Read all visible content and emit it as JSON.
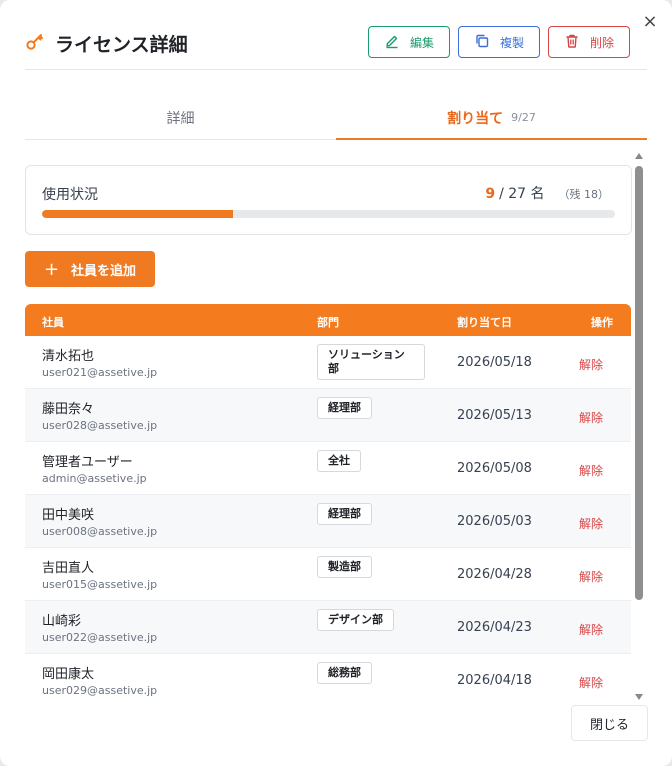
{
  "modal": {
    "title": "ライセンス詳細",
    "close_label": "×",
    "footer_close": "閉じる"
  },
  "toolbar": {
    "edit_label": "編集",
    "copy_label": "複製",
    "delete_label": "削除"
  },
  "tabs": [
    {
      "label": "詳細",
      "count": ""
    },
    {
      "label": "割り当て",
      "count": "9/27"
    }
  ],
  "usage": {
    "label": "使用状況",
    "used": "9",
    "total": "/ 27 名",
    "remaining": "（残 18）",
    "fraction": 0.3333
  },
  "add_button": {
    "plus": "+",
    "label": "社員を追加"
  },
  "table": {
    "headers": [
      "社員",
      "部門",
      "割り当て日",
      "操作"
    ],
    "rows": [
      {
        "name": "清水拓也",
        "email": "user021@assetive.jp",
        "dept": "ソリューション部",
        "date": "2026/05/18",
        "action": "解除"
      },
      {
        "name": "藤田奈々",
        "email": "user028@assetive.jp",
        "dept": "経理部",
        "date": "2026/05/13",
        "action": "解除"
      },
      {
        "name": "管理者ユーザー",
        "email": "admin@assetive.jp",
        "dept": "全社",
        "date": "2026/05/08",
        "action": "解除"
      },
      {
        "name": "田中美咲",
        "email": "user008@assetive.jp",
        "dept": "経理部",
        "date": "2026/05/03",
        "action": "解除"
      },
      {
        "name": "吉田直人",
        "email": "user015@assetive.jp",
        "dept": "製造部",
        "date": "2026/04/28",
        "action": "解除"
      },
      {
        "name": "山崎彩",
        "email": "user022@assetive.jp",
        "dept": "デザイン部",
        "date": "2026/04/23",
        "action": "解除"
      },
      {
        "name": "岡田康太",
        "email": "user029@assetive.jp",
        "dept": "総務部",
        "date": "2026/04/18",
        "action": "解除"
      }
    ]
  },
  "colors": {
    "accent": "#f07a22",
    "edit": "#1a9b6c",
    "copy": "#3b6fd8",
    "delete": "#d64545"
  }
}
